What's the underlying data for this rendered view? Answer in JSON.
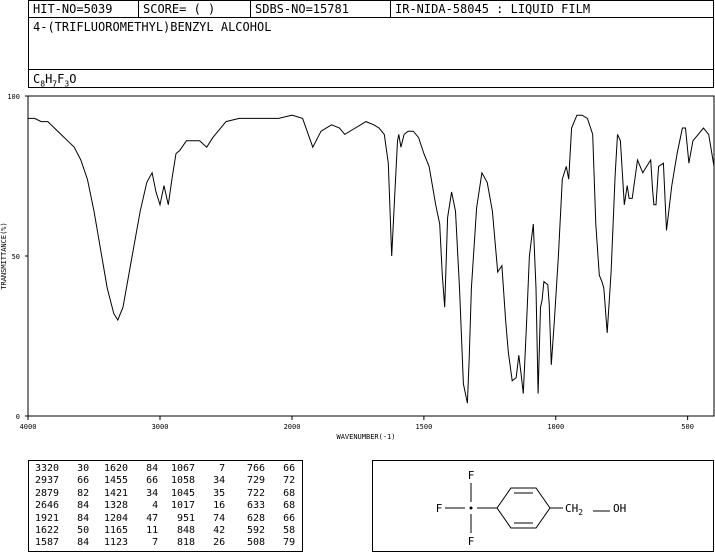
{
  "header": {
    "hit_no": "HIT-NO=5039",
    "score": "SCORE=  (   )",
    "sdbs_no": "SDBS-NO=15781",
    "ir_id": "IR-NIDA-58045 : LIQUID FILM",
    "compound_name": "4-(TRIFLUOROMETHYL)BENZYL ALCOHOL",
    "formula_parts": [
      "C",
      "8",
      "H",
      "7",
      "F",
      "3",
      "O"
    ]
  },
  "chart_data": {
    "type": "line",
    "xlabel": "WAVENUMBER(-1)",
    "ylabel": "TRANSMITTANCE(%)",
    "xlim": [
      4000,
      400
    ],
    "ylim": [
      0,
      100
    ],
    "x_ticks": [
      "4000",
      "3000",
      "2000",
      "1500",
      "1000",
      "500"
    ],
    "y_ticks": [
      "100",
      "50",
      "0"
    ],
    "grid": false,
    "series": [
      {
        "x": [
          4000,
          3950,
          3900,
          3850,
          3800,
          3750,
          3700,
          3650,
          3600,
          3550,
          3500,
          3450,
          3400,
          3350,
          3320,
          3280,
          3220,
          3150,
          3100,
          3060,
          3030,
          3000,
          2970,
          2937,
          2910,
          2879,
          2850,
          2800,
          2750,
          2700,
          2646,
          2600,
          2500,
          2400,
          2300,
          2200,
          2100,
          2000,
          1960,
          1921,
          1890,
          1850,
          1820,
          1800,
          1760,
          1720,
          1690,
          1670,
          1650,
          1635,
          1622,
          1610,
          1600,
          1595,
          1587,
          1575,
          1560,
          1540,
          1520,
          1500,
          1480,
          1455,
          1440,
          1430,
          1421,
          1410,
          1395,
          1380,
          1365,
          1350,
          1335,
          1328,
          1320,
          1300,
          1280,
          1260,
          1240,
          1220,
          1204,
          1190,
          1180,
          1165,
          1150,
          1140,
          1130,
          1123,
          1110,
          1100,
          1085,
          1075,
          1067,
          1058,
          1052,
          1045,
          1030,
          1025,
          1017,
          1005,
          990,
          975,
          960,
          951,
          940,
          920,
          900,
          880,
          860,
          848,
          835,
          825,
          818,
          805,
          790,
          775,
          766,
          755,
          740,
          729,
          722,
          710,
          690,
          670,
          655,
          640,
          633,
          628,
          620,
          610,
          592,
          580,
          560,
          540,
          520,
          508,
          495,
          480,
          460,
          440,
          420,
          400
        ],
        "y": [
          93,
          93,
          92,
          92,
          90,
          88,
          86,
          84,
          80,
          74,
          64,
          52,
          40,
          32,
          30,
          34,
          48,
          64,
          73,
          76,
          70,
          66,
          72,
          66,
          74,
          82,
          83,
          86,
          86,
          86,
          84,
          87,
          92,
          93,
          93,
          93,
          93,
          94,
          93,
          84,
          89,
          91,
          90,
          88,
          90,
          92,
          91,
          90,
          88,
          79,
          50,
          70,
          86,
          88,
          84,
          88,
          89,
          89,
          87,
          82,
          78,
          66,
          60,
          44,
          34,
          62,
          70,
          64,
          40,
          10,
          4,
          18,
          40,
          65,
          76,
          73,
          64,
          45,
          47,
          30,
          20,
          11,
          12,
          19,
          12,
          7,
          30,
          50,
          60,
          40,
          7,
          34,
          36,
          42,
          41,
          35,
          16,
          30,
          50,
          74,
          78,
          74,
          90,
          94,
          94,
          93,
          88,
          60,
          44,
          42,
          40,
          26,
          45,
          75,
          88,
          86,
          66,
          72,
          68,
          68,
          80,
          76,
          78,
          80,
          71,
          66,
          66,
          78,
          79,
          58,
          72,
          82,
          90,
          90,
          79,
          86,
          88,
          90,
          88,
          78
        ]
      }
    ]
  },
  "peak_table": [
    [
      "3320",
      "30"
    ],
    [
      "2937",
      "66"
    ],
    [
      "2879",
      "82"
    ],
    [
      "2646",
      "84"
    ],
    [
      "1921",
      "84"
    ],
    [
      "1622",
      "50"
    ],
    [
      "1587",
      "84"
    ],
    [
      "1620",
      "84"
    ],
    [
      "1455",
      "66"
    ],
    [
      "1421",
      "34"
    ],
    [
      "1328",
      "4"
    ],
    [
      "1204",
      "47"
    ],
    [
      "1165",
      "11"
    ],
    [
      "1123",
      "7"
    ],
    [
      "1067",
      "7"
    ],
    [
      "1058",
      "34"
    ],
    [
      "1045",
      "35"
    ],
    [
      "1017",
      "16"
    ],
    [
      "951",
      "74"
    ],
    [
      "848",
      "42"
    ],
    [
      "818",
      "26"
    ],
    [
      "766",
      "66"
    ],
    [
      "729",
      "72"
    ],
    [
      "722",
      "68"
    ],
    [
      "633",
      "68"
    ],
    [
      "628",
      "66"
    ],
    [
      "592",
      "58"
    ],
    [
      "508",
      "79"
    ]
  ],
  "structure": {
    "f_top": "F",
    "f_left": "F",
    "f_bottom": "F",
    "ch2_main": "CH",
    "ch2_sub": "2",
    "oh": "OH"
  }
}
